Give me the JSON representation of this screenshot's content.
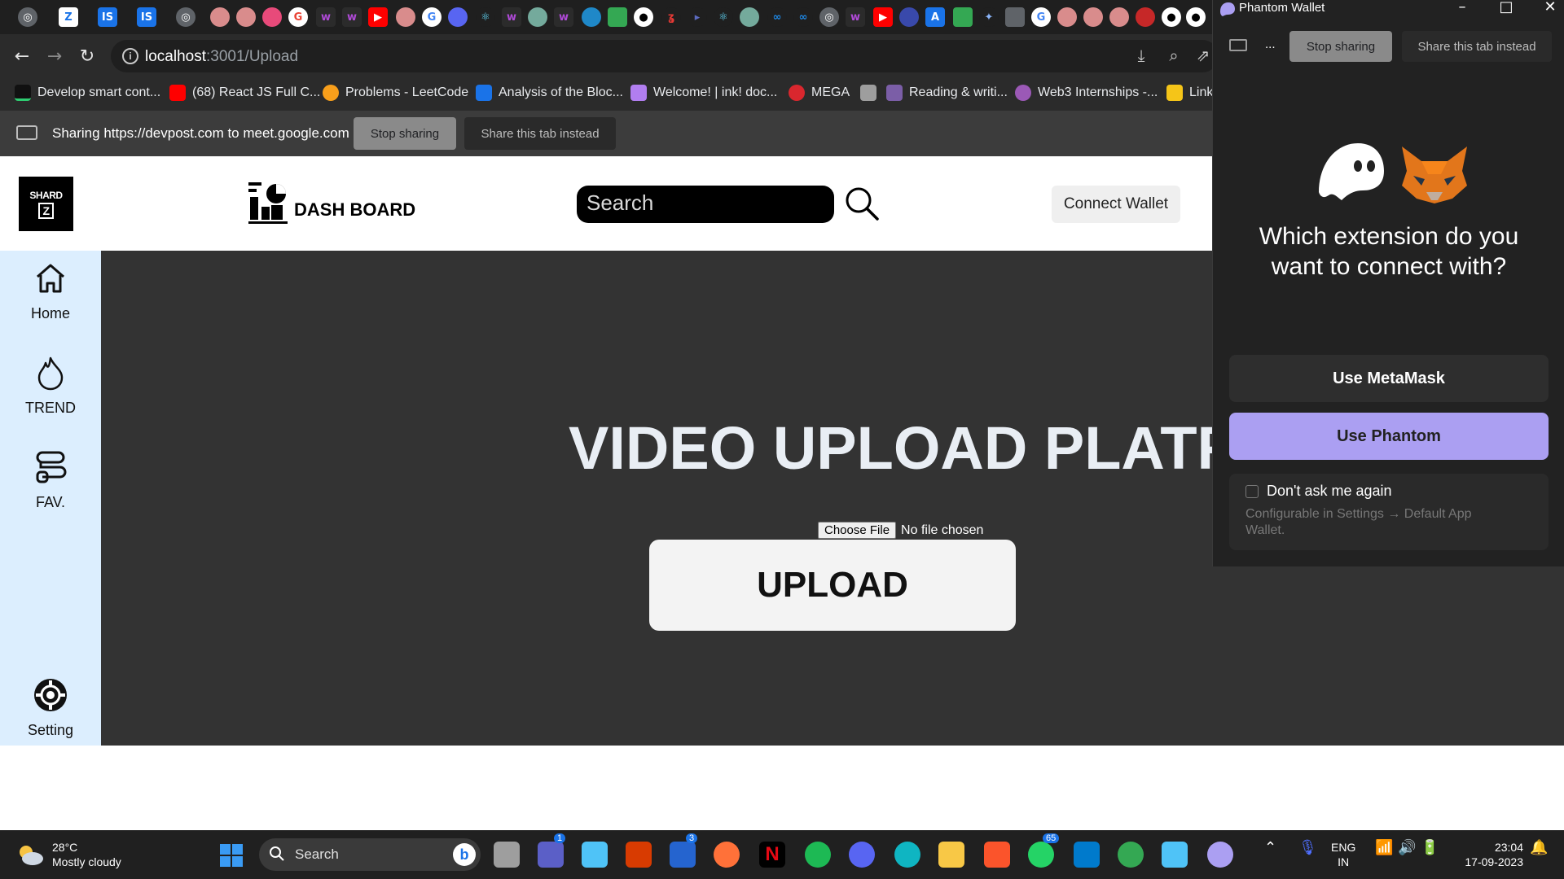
{
  "browser": {
    "url_host": "localhost",
    "url_path": ":3001/Upload",
    "bookmarks": [
      {
        "label": "Develop smart cont...",
        "color": "#111111"
      },
      {
        "label": "(68) React JS Full C...",
        "color": "#ff0000"
      },
      {
        "label": "Problems - LeetCode",
        "color": "#f89f1b"
      },
      {
        "label": "Analysis of the Bloc...",
        "color": "#1a73e8"
      },
      {
        "label": "Welcome! | ink! doc...",
        "color": "#b17ef0"
      },
      {
        "label": "MEGA",
        "color": "#d9272e"
      },
      {
        "label": "",
        "color": "#9e9e9e"
      },
      {
        "label": "Reading & writi...",
        "color": "#7b5ea7"
      },
      {
        "label": "Web3 Internships -...",
        "color": "#9b59b6"
      },
      {
        "label": "Link",
        "color": "#f5c518"
      }
    ],
    "sharebar": {
      "text": "Sharing https://devpost.com to meet.google.com",
      "stop_label": "Stop sharing",
      "share_label": "Share this tab instead"
    }
  },
  "app": {
    "logo_text_top": "SHARD",
    "logo_text_bottom": "Z",
    "dashboard_label": "DASH BOARD",
    "search_placeholder": "Search",
    "connect_wallet_label": "Connect Wallet",
    "sidebar": [
      {
        "label": "Home",
        "icon": "home-icon"
      },
      {
        "label": "TREND",
        "icon": "flame-icon"
      },
      {
        "label": "FAV.",
        "icon": "favorites-icon"
      },
      {
        "label": "Setting",
        "icon": "gear-icon"
      }
    ],
    "heading": "VIDEO UPLOAD PLATFORM",
    "file_button_label": "Choose File",
    "file_status": "No file chosen",
    "upload_label": "UPLOAD"
  },
  "phantom": {
    "window_title": "Phantom Wallet",
    "share_ellipsis": "...",
    "stop_label": "Stop sharing",
    "share_label": "Share this tab instead",
    "question": "Which extension do you want to connect with?",
    "metamask_label": "Use MetaMask",
    "phantom_label": "Use Phantom",
    "dont_ask_label": "Don't ask me again",
    "hint": "Configurable in Settings → Default App Wallet.",
    "accent_color": "#ab9ff2"
  },
  "taskbar": {
    "temperature": "28°C",
    "weather": "Mostly cloudy",
    "search_label": "Search",
    "language": "ENG",
    "region": "IN",
    "time": "23:04",
    "date": "17-09-2023",
    "badges": {
      "teams": "1",
      "todo": "3",
      "whatsapp": "65"
    }
  }
}
